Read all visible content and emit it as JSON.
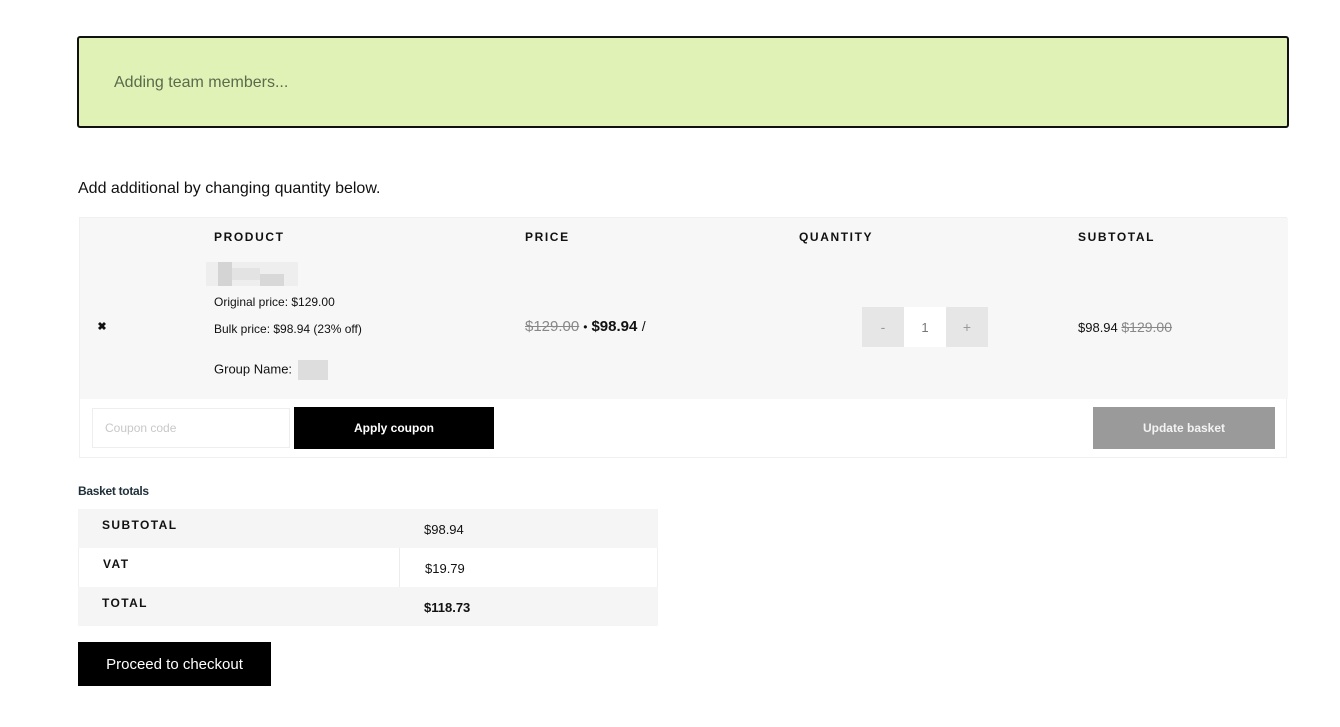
{
  "notice": {
    "message": "Adding team members..."
  },
  "intro_text": "Add additional by changing quantity below.",
  "cart": {
    "headers": {
      "product": "PRODUCT",
      "price": "PRICE",
      "quantity": "QUANTITY",
      "subtotal": "SUBTOTAL"
    },
    "item": {
      "remove_icon": "close-icon",
      "original_price_line": "Original price: $129.00",
      "bulk_price_line": "Bulk price: $98.94 (23% off)",
      "group_name_label": "Group Name:",
      "price_old": "$129.00",
      "price_separator": "•",
      "price_new": "$98.94",
      "price_suffix": "/",
      "quantity": "1",
      "qty_minus": "-",
      "qty_plus": "+",
      "subtotal_new": "$98.94",
      "subtotal_old": "$129.00"
    },
    "coupon_placeholder": "Coupon code",
    "apply_coupon_label": "Apply coupon",
    "update_basket_label": "Update basket"
  },
  "totals": {
    "title": "Basket totals",
    "rows": [
      {
        "label": "SUBTOTAL",
        "value": "$98.94"
      },
      {
        "label": "VAT",
        "value": "$19.79"
      },
      {
        "label": "TOTAL",
        "value": "$118.73"
      }
    ]
  },
  "checkout_label": "Proceed to checkout",
  "colors": {
    "notice_bg": "#e0f2b6",
    "primary_button": "#000000",
    "disabled_button": "#9a9a9a"
  }
}
